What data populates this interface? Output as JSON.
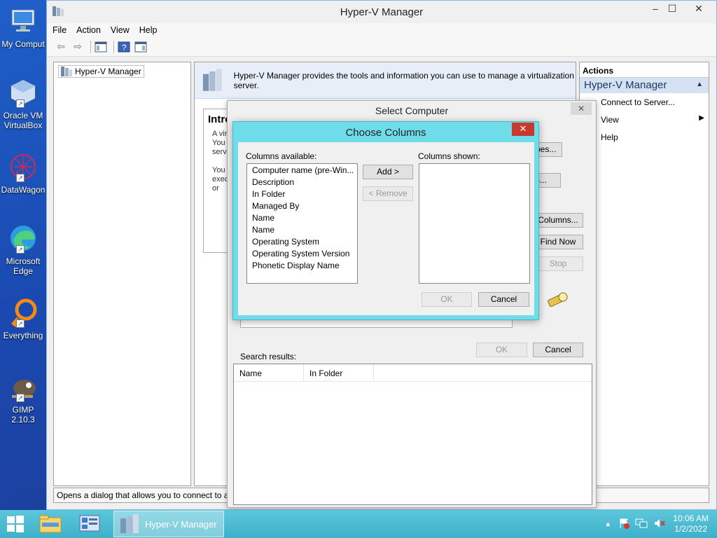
{
  "desktop": {
    "icons": [
      {
        "label": "My Comput",
        "icon": "computer-icon"
      },
      {
        "label": "Oracle VM VirtualBox",
        "icon": "virtualbox-icon"
      },
      {
        "label": "DataWagon",
        "icon": "datawagon-icon"
      },
      {
        "label": "Microsoft Edge",
        "icon": "edge-icon"
      },
      {
        "label": "Everything",
        "icon": "everything-icon"
      },
      {
        "label": "GIMP 2.10.3",
        "icon": "gimp-icon"
      }
    ]
  },
  "window": {
    "title": "Hyper-V Manager",
    "menu": [
      "File",
      "Action",
      "View",
      "Help"
    ],
    "tree": {
      "root": "Hyper-V Manager"
    },
    "center": {
      "header_text": "Hyper-V Manager provides the tools and information you can use to manage a virtualization server.",
      "intro_title": "Intro",
      "intro_lines": [
        "A virt",
        "You c",
        "serve",
        "",
        "You c",
        "exec",
        "or"
      ]
    },
    "actions": {
      "heading": "Actions",
      "subheading": "Hyper-V Manager",
      "items": [
        "Connect to Server...",
        "View",
        "Help"
      ]
    },
    "status": "Opens a dialog that allows you to connect to a"
  },
  "select_computer": {
    "title": "Select Computer",
    "buttons": {
      "types": "pes...",
      "locations": "s...",
      "columns": "Columns...",
      "find_now": "Find Now",
      "stop": "Stop",
      "ok": "OK",
      "cancel": "Cancel"
    },
    "search_results_label": "Search results:",
    "results_columns": [
      "Name",
      "In Folder"
    ]
  },
  "choose_columns": {
    "title": "Choose Columns",
    "available_label": "Columns available:",
    "shown_label": "Columns shown:",
    "available": [
      "Computer name (pre-Win...",
      "Description",
      "In Folder",
      "Managed By",
      "Name",
      "Name",
      "Operating System",
      "Operating System Version",
      "Phonetic Display Name"
    ],
    "shown": [],
    "add_label": "Add >",
    "remove_label": "< Remove",
    "ok_label": "OK",
    "cancel_label": "Cancel"
  },
  "taskbar": {
    "active_app": "Hyper-V Manager",
    "time": "10:06 AM",
    "date": "1/2/2022"
  }
}
